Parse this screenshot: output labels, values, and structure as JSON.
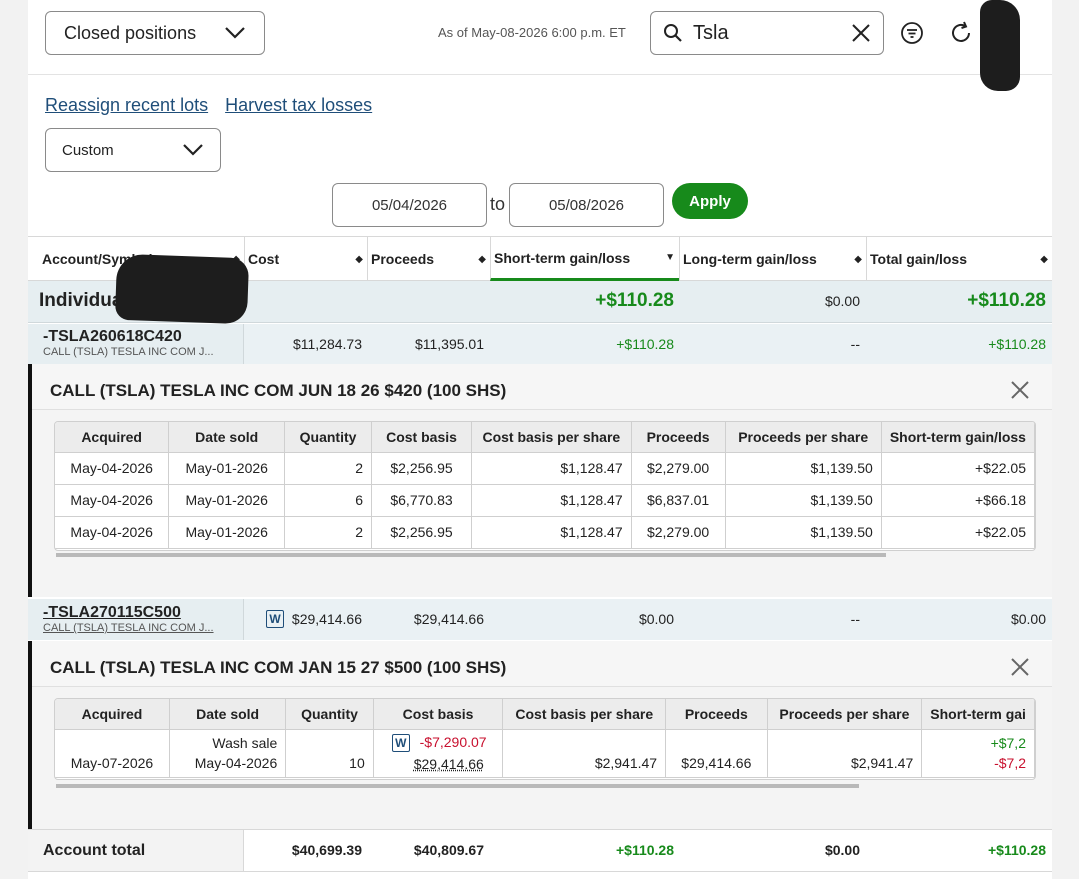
{
  "header": {
    "view_select": "Closed positions",
    "as_of": "As of May-08-2026 6:00 p.m. ET",
    "search_value": "Tsla"
  },
  "links": {
    "reassign": "Reassign recent lots",
    "harvest": "Harvest tax losses"
  },
  "range": {
    "period_select": "Custom",
    "from": "05/04/2026",
    "to_label": "to",
    "to": "05/08/2026",
    "apply": "Apply"
  },
  "columns": {
    "account": "Account/Symbol",
    "cost": "Cost",
    "proceeds": "Proceeds",
    "short_term": "Short-term gain/loss",
    "long_term": "Long-term gain/loss",
    "total": "Total gain/loss"
  },
  "account_row": {
    "name": "Individua",
    "short_term": "+$110.28",
    "long_term": "$0.00",
    "total": "+$110.28"
  },
  "positions": [
    {
      "symbol": "-TSLA260618C420",
      "description": "CALL (TSLA) TESLA INC COM J...",
      "cost": "$11,284.73",
      "proceeds": "$11,395.01",
      "short_term": "+$110.28",
      "long_term": "--",
      "total": "+$110.28",
      "detail": {
        "title": "CALL (TSLA) TESLA INC COM JUN 18 26 $420 (100 SHS)",
        "headers": [
          "Acquired",
          "Date sold",
          "Quantity",
          "Cost basis",
          "Cost basis per share",
          "Proceeds",
          "Proceeds per share",
          "Short-term gain/loss"
        ],
        "rows": [
          [
            "May-04-2026",
            "May-01-2026",
            "2",
            "$2,256.95",
            "$1,128.47",
            "$2,279.00",
            "$1,139.50",
            "+$22.05"
          ],
          [
            "May-04-2026",
            "May-01-2026",
            "6",
            "$6,770.83",
            "$1,128.47",
            "$6,837.01",
            "$1,139.50",
            "+$66.18"
          ],
          [
            "May-04-2026",
            "May-01-2026",
            "2",
            "$2,256.95",
            "$1,128.47",
            "$2,279.00",
            "$1,139.50",
            "+$22.05"
          ]
        ]
      }
    },
    {
      "symbol": "-TSLA270115C500",
      "description": "CALL (TSLA) TESLA INC COM J...",
      "badge": "W",
      "cost": "$29,414.66",
      "proceeds": "$29,414.66",
      "short_term": "$0.00",
      "long_term": "--",
      "total": "$0.00",
      "detail": {
        "title": "CALL (TSLA) TESLA INC COM JAN 15 27 $500 (100 SHS)",
        "headers": [
          "Acquired",
          "Date sold",
          "Quantity",
          "Cost basis",
          "Cost basis per share",
          "Proceeds",
          "Proceeds per share",
          "Short-term gai"
        ],
        "row": {
          "acquired": "May-07-2026",
          "sold_note": "Wash sale",
          "sold": "May-04-2026",
          "quantity": "10",
          "badge": "W",
          "wash_adjustment": "-$7,290.07",
          "cost_basis": "$29,414.66",
          "cost_per_share": "$2,941.47",
          "proceeds": "$29,414.66",
          "proceeds_per_share": "$2,941.47",
          "gain_top": "+$7,2",
          "gain_bottom": "-$7,2"
        }
      }
    }
  ],
  "total_row": {
    "label": "Account total",
    "cost": "$40,699.39",
    "proceeds": "$40,809.67",
    "short_term": "+$110.28",
    "long_term": "$0.00",
    "total": "+$110.28"
  },
  "colors": {
    "gain": "#178a1b",
    "loss": "#c8102e",
    "link": "#1f4e79",
    "apply_button": "#178a1b"
  },
  "icons": [
    "chevron-down-icon",
    "search-icon",
    "clear-icon",
    "filter-icon",
    "refresh-icon",
    "sort-icon",
    "close-icon",
    "wash-sale-badge"
  ]
}
